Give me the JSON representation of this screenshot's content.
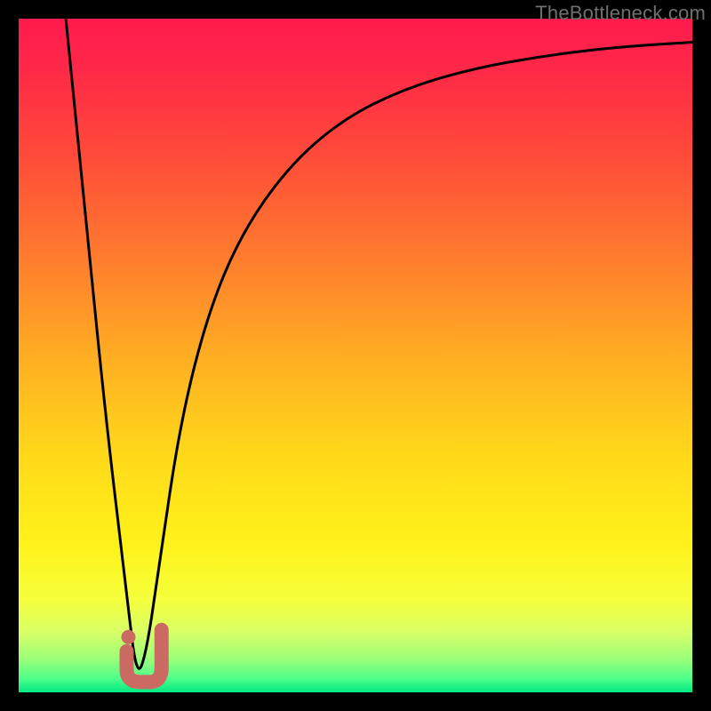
{
  "watermark": {
    "text": "TheBottleneck.com"
  },
  "colors": {
    "black": "#000000",
    "curve": "#000000",
    "marker": "#cb6a63",
    "gradient_stops": [
      {
        "offset": 0.0,
        "color": "#ff1a4d"
      },
      {
        "offset": 0.08,
        "color": "#ff2a47"
      },
      {
        "offset": 0.2,
        "color": "#ff4a3a"
      },
      {
        "offset": 0.35,
        "color": "#ff7a2e"
      },
      {
        "offset": 0.5,
        "color": "#ffad22"
      },
      {
        "offset": 0.65,
        "color": "#ffd91a"
      },
      {
        "offset": 0.78,
        "color": "#fff21a"
      },
      {
        "offset": 0.86,
        "color": "#f6ff3a"
      },
      {
        "offset": 0.91,
        "color": "#d9ff66"
      },
      {
        "offset": 0.95,
        "color": "#9cff7a"
      },
      {
        "offset": 0.98,
        "color": "#4dff8a"
      },
      {
        "offset": 1.0,
        "color": "#00e884"
      }
    ]
  },
  "chart_data": {
    "type": "line",
    "title": "",
    "xlabel": "",
    "ylabel": "",
    "xlim": [
      0,
      100
    ],
    "ylim": [
      0,
      100
    ],
    "grid": false,
    "legend": false,
    "series": [
      {
        "name": "bottleneck-curve",
        "x": [
          7,
          10,
          13,
          16,
          17.5,
          19,
          21,
          24,
          28,
          33,
          40,
          48,
          57,
          67,
          78,
          89,
          100
        ],
        "y": [
          100,
          70,
          40,
          15,
          2,
          6,
          20,
          40,
          56,
          68,
          78,
          85,
          89.5,
          92.5,
          94.5,
          95.8,
          96.5
        ]
      }
    ],
    "marker": {
      "name": "optimal-point",
      "shape": "J",
      "x": 17.5,
      "y": 2,
      "box_x_pct": [
        15.5,
        22.0
      ],
      "box_y_pct": [
        1.0,
        9.0
      ]
    }
  }
}
